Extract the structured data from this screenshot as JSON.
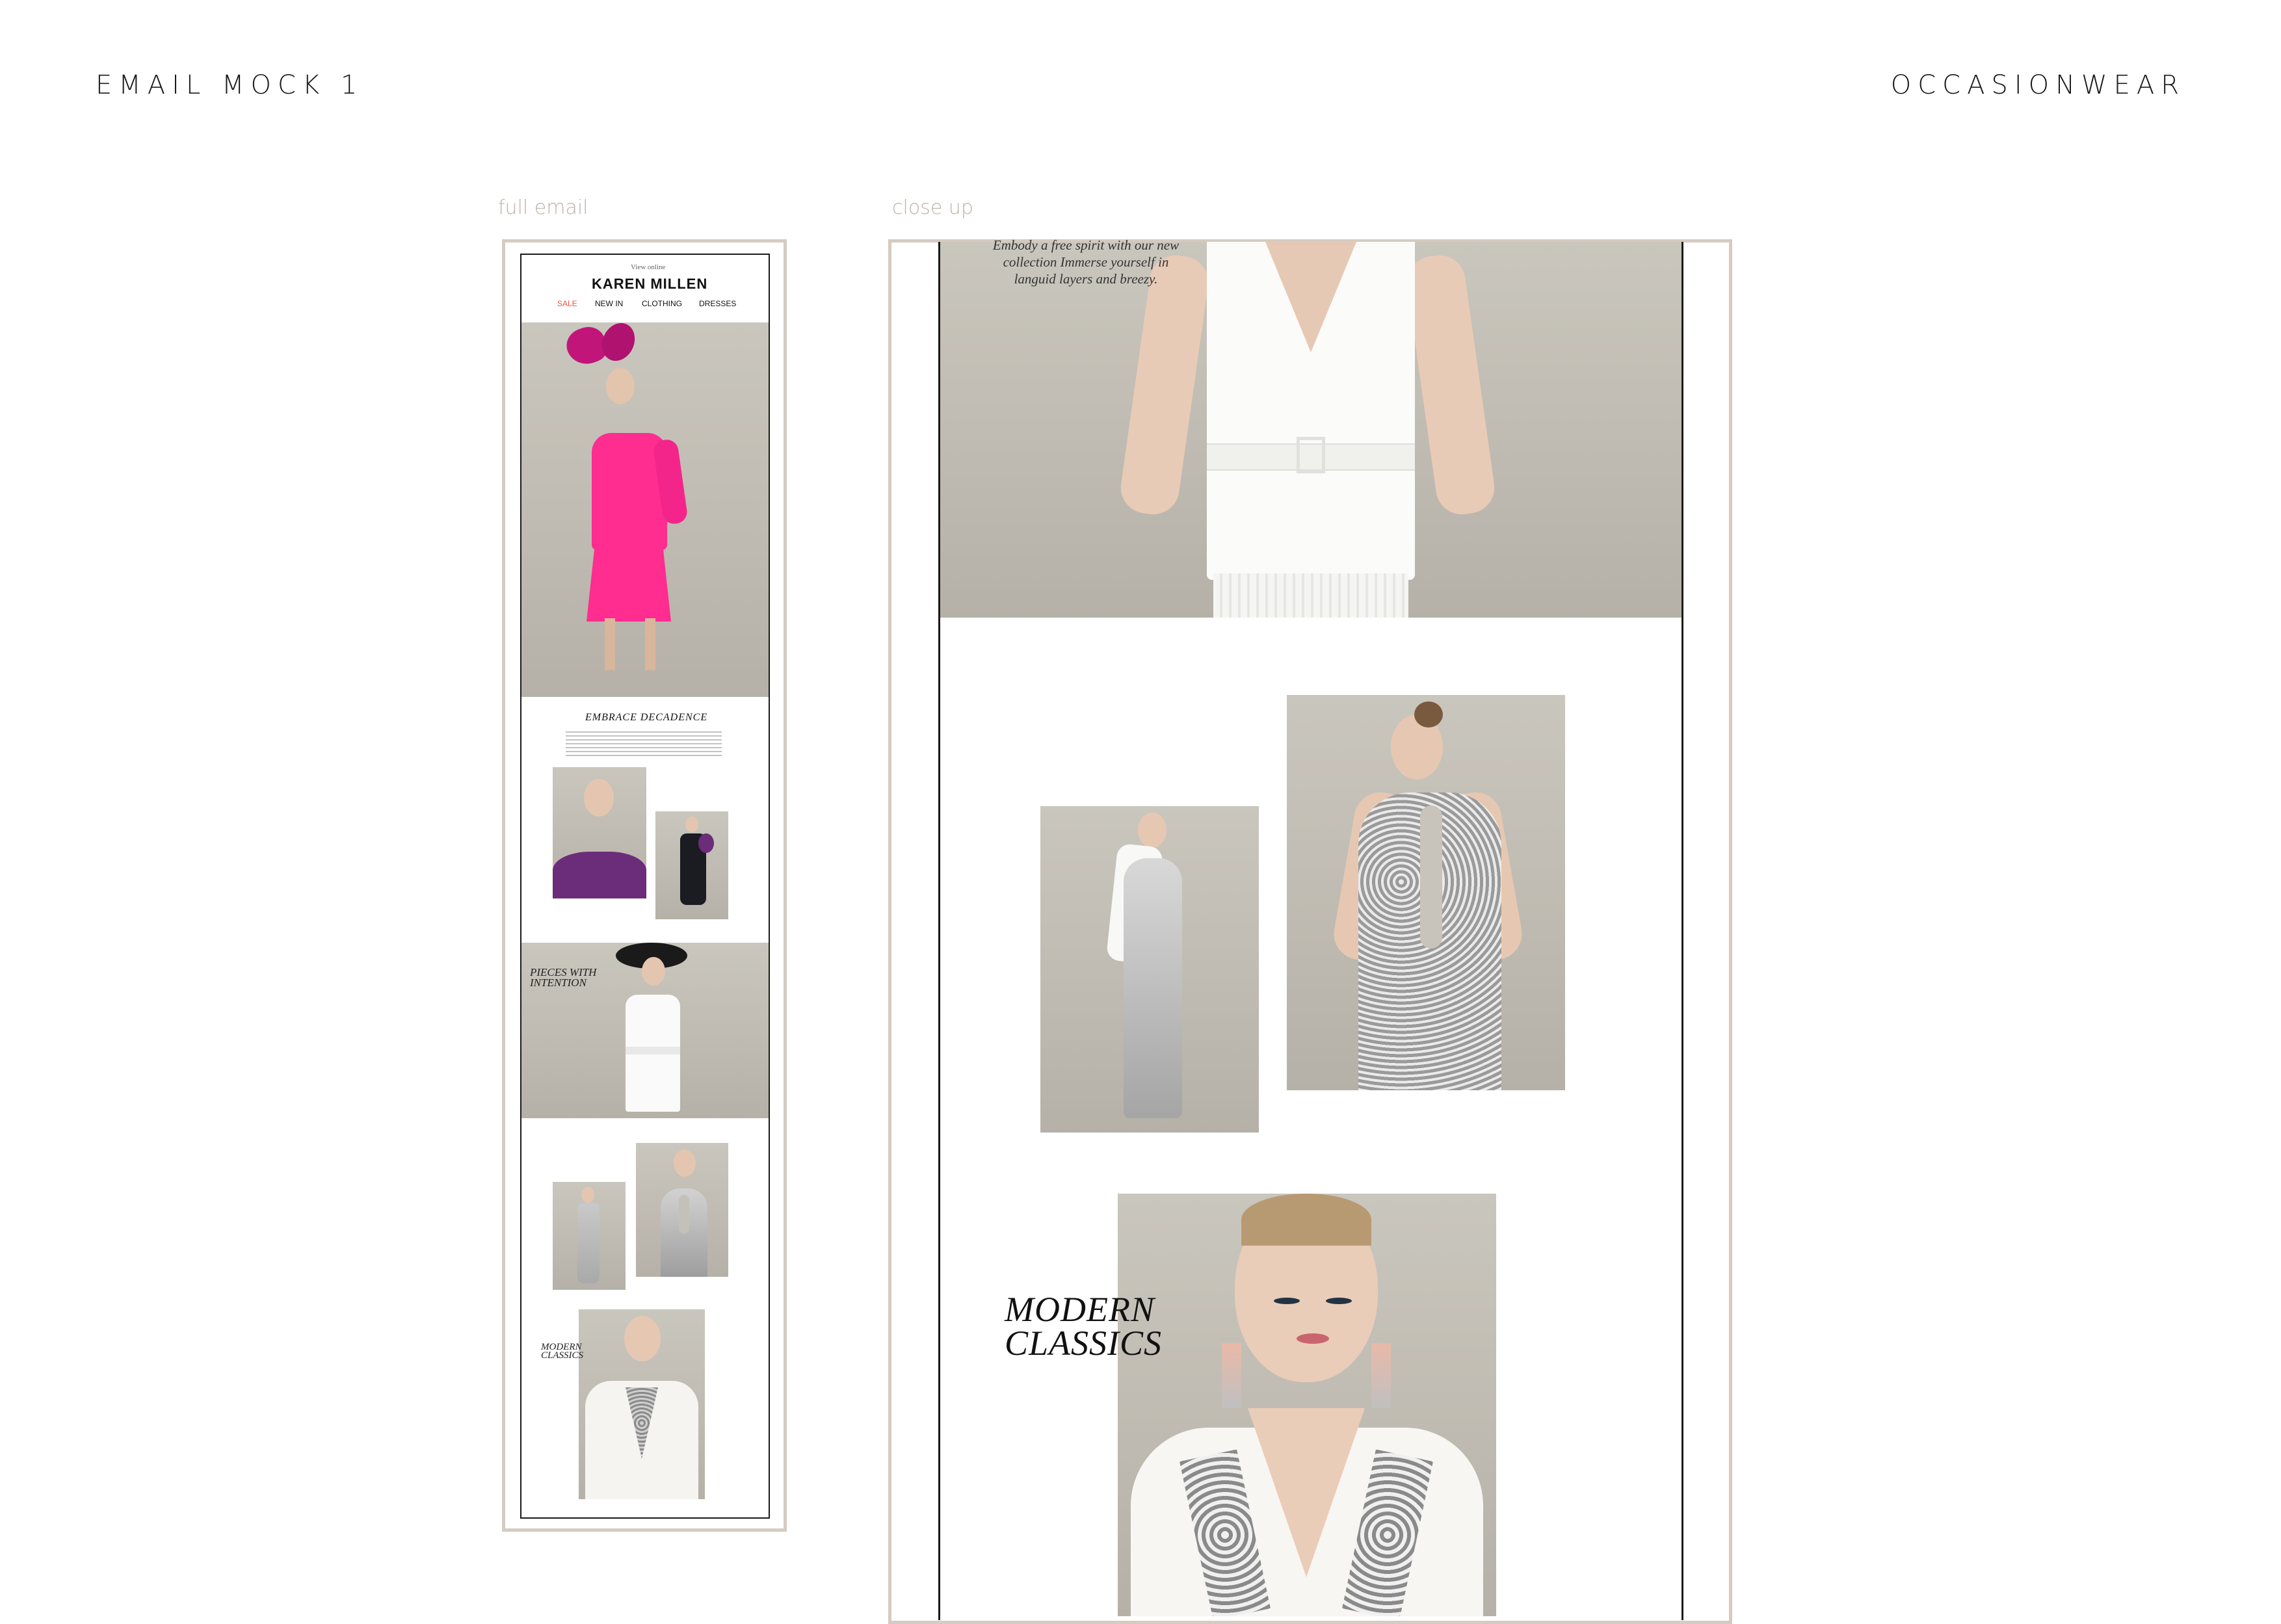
{
  "header": {
    "left_title": "EMAIL MOCK 1",
    "right_title": "OCCASIONWEAR"
  },
  "captions": {
    "full_email": "full email",
    "close_up": "close up"
  },
  "email": {
    "preheader": "View online",
    "brand": "KAREN MILLEN",
    "nav": [
      {
        "label": "SALE",
        "color": "#e8543a"
      },
      {
        "label": "NEW IN",
        "color": "#111111"
      },
      {
        "label": "CLOTHING",
        "color": "#111111"
      },
      {
        "label": "DRESSES",
        "color": "#111111"
      }
    ],
    "section1_title": "EMBRACE DECADENCE",
    "section2_title_line1": "PIECES WITH",
    "section2_title_line2": "INTENTION",
    "section3_title_line1": "MODERN",
    "section3_title_line2": "CLASSICS"
  },
  "closeup": {
    "intro_line1": "Embody a free spirit with our new",
    "intro_line2": "collection Immerse yourself in",
    "intro_line3": "languid layers and breezy.",
    "title_line1": "MODERN",
    "title_line2": "CLASSICS"
  },
  "colors": {
    "accent_sale": "#e8543a",
    "frame_border": "#d5cbc1",
    "caption": "#bdb2a6",
    "wall": "#c4c1b8",
    "pink": "#ff2d8f",
    "purple": "#6b2c7a"
  }
}
